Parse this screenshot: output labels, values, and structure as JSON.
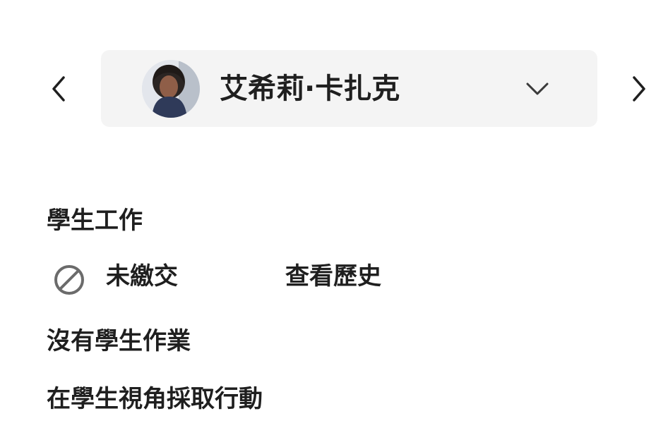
{
  "navigation": {
    "previous_icon": "chevron-left-icon",
    "next_icon": "chevron-right-icon"
  },
  "student_selector": {
    "name": "艾希莉·卡扎克",
    "avatar_icon": "student-avatar",
    "dropdown_icon": "chevron-down-icon"
  },
  "student_work": {
    "section_title": "學生工作",
    "status": {
      "icon": "blocked-circle-icon",
      "label": "未繳交",
      "view_history_label": "查看歷史"
    },
    "no_work_message": "沒有學生作業",
    "student_view_action_label": "在學生視角採取行動"
  },
  "colors": {
    "background": "#ffffff",
    "selector_background": "#f4f4f4",
    "text": "#1f1f1f",
    "icon_gray": "#6b6b6b"
  }
}
